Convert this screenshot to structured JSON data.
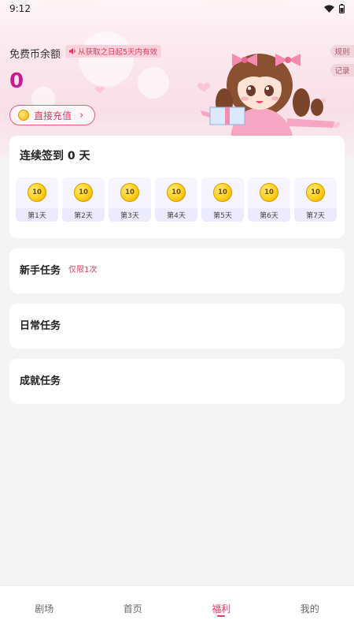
{
  "status_bar": {
    "time": "9:12"
  },
  "balance": {
    "label": "免费币余额",
    "notice": "从获取之日起5天内有效",
    "value": "0",
    "recharge_label": "直接充值"
  },
  "side_tabs": {
    "rules": "规则",
    "records": "记录"
  },
  "signin": {
    "title": "连续签到 0 天",
    "days": [
      {
        "coins": "10",
        "label": "第1天"
      },
      {
        "coins": "10",
        "label": "第2天"
      },
      {
        "coins": "10",
        "label": "第3天"
      },
      {
        "coins": "10",
        "label": "第4天"
      },
      {
        "coins": "10",
        "label": "第5天"
      },
      {
        "coins": "10",
        "label": "第6天"
      },
      {
        "coins": "10",
        "label": "第7天"
      }
    ]
  },
  "tasks": {
    "newbie": {
      "title": "新手任务",
      "tag": "仅限1次"
    },
    "daily": {
      "title": "日常任务"
    },
    "achievement": {
      "title": "成就任务"
    }
  },
  "tabbar": {
    "items": [
      {
        "label": "剧场"
      },
      {
        "label": "首页"
      },
      {
        "label": "福利"
      },
      {
        "label": "我的"
      }
    ]
  },
  "colors": {
    "accent": "#e2395f",
    "balance": "#c41d8f"
  }
}
